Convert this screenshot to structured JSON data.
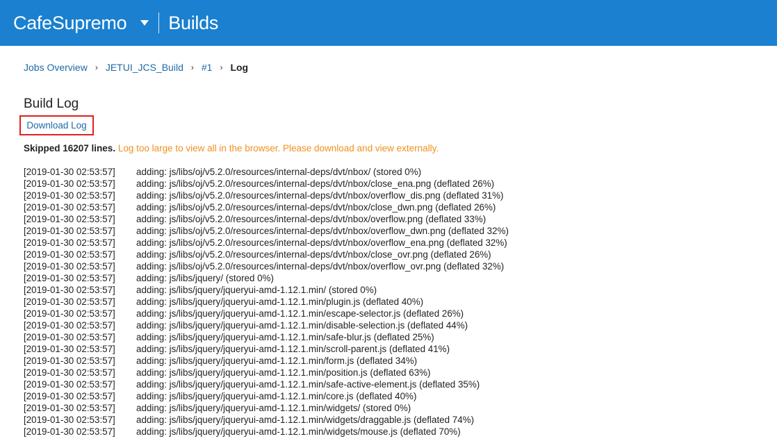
{
  "header": {
    "brand": "CafeSupremo",
    "section": "Builds"
  },
  "breadcrumb": {
    "items": [
      "Jobs Overview",
      "JETUI_JCS_Build",
      "#1"
    ],
    "current": "Log"
  },
  "page": {
    "title": "Build Log",
    "download_label": "Download Log",
    "skipped_text": "Skipped 16207 lines.",
    "warning_text": "Log too large to view all in the browser. Please download and view externally."
  },
  "log": [
    {
      "ts": "[2019-01-30 02:53:57]",
      "msg": "adding: js/libs/oj/v5.2.0/resources/internal-deps/dvt/nbox/ (stored 0%)"
    },
    {
      "ts": "[2019-01-30 02:53:57]",
      "msg": "adding: js/libs/oj/v5.2.0/resources/internal-deps/dvt/nbox/close_ena.png (deflated 26%)"
    },
    {
      "ts": "[2019-01-30 02:53:57]",
      "msg": "adding: js/libs/oj/v5.2.0/resources/internal-deps/dvt/nbox/overflow_dis.png (deflated 31%)"
    },
    {
      "ts": "[2019-01-30 02:53:57]",
      "msg": "adding: js/libs/oj/v5.2.0/resources/internal-deps/dvt/nbox/close_dwn.png (deflated 26%)"
    },
    {
      "ts": "[2019-01-30 02:53:57]",
      "msg": "adding: js/libs/oj/v5.2.0/resources/internal-deps/dvt/nbox/overflow.png (deflated 33%)"
    },
    {
      "ts": "[2019-01-30 02:53:57]",
      "msg": "adding: js/libs/oj/v5.2.0/resources/internal-deps/dvt/nbox/overflow_dwn.png (deflated 32%)"
    },
    {
      "ts": "[2019-01-30 02:53:57]",
      "msg": "adding: js/libs/oj/v5.2.0/resources/internal-deps/dvt/nbox/overflow_ena.png (deflated 32%)"
    },
    {
      "ts": "[2019-01-30 02:53:57]",
      "msg": "adding: js/libs/oj/v5.2.0/resources/internal-deps/dvt/nbox/close_ovr.png (deflated 26%)"
    },
    {
      "ts": "[2019-01-30 02:53:57]",
      "msg": "adding: js/libs/oj/v5.2.0/resources/internal-deps/dvt/nbox/overflow_ovr.png (deflated 32%)"
    },
    {
      "ts": "[2019-01-30 02:53:57]",
      "msg": "adding: js/libs/jquery/ (stored 0%)"
    },
    {
      "ts": "[2019-01-30 02:53:57]",
      "msg": "adding: js/libs/jquery/jqueryui-amd-1.12.1.min/ (stored 0%)"
    },
    {
      "ts": "[2019-01-30 02:53:57]",
      "msg": "adding: js/libs/jquery/jqueryui-amd-1.12.1.min/plugin.js (deflated 40%)"
    },
    {
      "ts": "[2019-01-30 02:53:57]",
      "msg": "adding: js/libs/jquery/jqueryui-amd-1.12.1.min/escape-selector.js (deflated 26%)"
    },
    {
      "ts": "[2019-01-30 02:53:57]",
      "msg": "adding: js/libs/jquery/jqueryui-amd-1.12.1.min/disable-selection.js (deflated 44%)"
    },
    {
      "ts": "[2019-01-30 02:53:57]",
      "msg": "adding: js/libs/jquery/jqueryui-amd-1.12.1.min/safe-blur.js (deflated 25%)"
    },
    {
      "ts": "[2019-01-30 02:53:57]",
      "msg": "adding: js/libs/jquery/jqueryui-amd-1.12.1.min/scroll-parent.js (deflated 41%)"
    },
    {
      "ts": "[2019-01-30 02:53:57]",
      "msg": "adding: js/libs/jquery/jqueryui-amd-1.12.1.min/form.js (deflated 34%)"
    },
    {
      "ts": "[2019-01-30 02:53:57]",
      "msg": "adding: js/libs/jquery/jqueryui-amd-1.12.1.min/position.js (deflated 63%)"
    },
    {
      "ts": "[2019-01-30 02:53:57]",
      "msg": "adding: js/libs/jquery/jqueryui-amd-1.12.1.min/safe-active-element.js (deflated 35%)"
    },
    {
      "ts": "[2019-01-30 02:53:57]",
      "msg": "adding: js/libs/jquery/jqueryui-amd-1.12.1.min/core.js (deflated 40%)"
    },
    {
      "ts": "[2019-01-30 02:53:57]",
      "msg": "adding: js/libs/jquery/jqueryui-amd-1.12.1.min/widgets/ (stored 0%)"
    },
    {
      "ts": "[2019-01-30 02:53:57]",
      "msg": "adding: js/libs/jquery/jqueryui-amd-1.12.1.min/widgets/draggable.js (deflated 74%)"
    },
    {
      "ts": "[2019-01-30 02:53:57]",
      "msg": "adding: js/libs/jquery/jqueryui-amd-1.12.1.min/widgets/mouse.js (deflated 70%)"
    }
  ]
}
